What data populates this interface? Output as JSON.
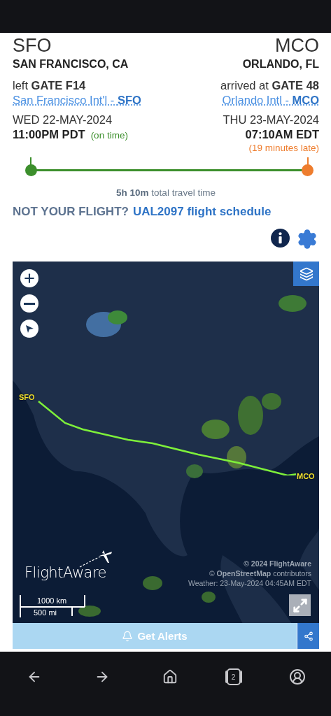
{
  "endpoints": [
    {
      "code": "SFO",
      "city": "SAN FRANCISCO, CA",
      "gate_prefix": "left",
      "gate": "GATE F14",
      "airport": "San Francisco Int'l - **SFO**",
      "date": "WED 22-MAY-2024",
      "time": "11:00PM PDT",
      "status": "(on time)",
      "color": "#3c8f2c"
    },
    {
      "code": "MCO",
      "city": "ORLANDO, FL",
      "gate_prefix": "arrived at",
      "gate": "GATE 48",
      "airport": "Orlando Intl - **MCO**",
      "date": "THU 23-MAY-2024",
      "time": "07:10AM EDT",
      "status": "(19 minutes late)",
      "color": "#ee7d2e"
    }
  ],
  "travel_time": "**5h 10m** total travel time",
  "not_your_flight": {
    "prompt": "NOT YOUR FLIGHT?",
    "link": "UAL2097 flight schedule"
  },
  "map": {
    "labels": [
      "SFO",
      "MCO"
    ],
    "logo": "FlightAware",
    "attribution": [
      "© 2024 FlightAware",
      "© **OpenStreetMap** contributors",
      "Weather: 23-May-2024 04:45AM EDT"
    ],
    "scale": [
      "1000 km",
      "500 mi"
    ]
  },
  "alerts_button": "Get Alerts",
  "nav": {
    "tab_count": "2"
  }
}
